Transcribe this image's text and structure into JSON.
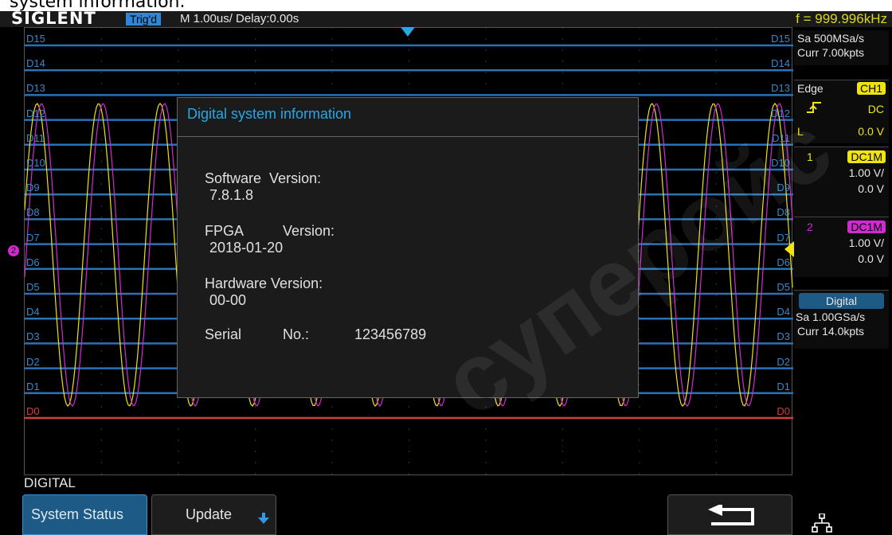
{
  "caption": "system information.",
  "header": {
    "logo": "SIGLENT",
    "trigger_status": "Trig'd",
    "timebase": "M 1.00us/  Delay:0.00s",
    "frequency": "f = 999.996kHz"
  },
  "channels_left": [
    "D15",
    "D14",
    "D13",
    "D12",
    "D11",
    "D10",
    "D9",
    "D8",
    "D7",
    "D6",
    "D5",
    "D4",
    "D3",
    "D2",
    "D1",
    "D0"
  ],
  "channels_right": [
    "D15",
    "D14",
    "D13",
    "D12",
    "D11",
    "D10",
    "D9",
    "D8",
    "D7",
    "D6",
    "D5",
    "D4",
    "D3",
    "D2",
    "D1",
    "D0"
  ],
  "marker_ch2": "2",
  "right_panel": {
    "sample_rate": "Sa 500MSa/s",
    "curr_pts": "Curr 7.00kpts",
    "trigger_type": "Edge",
    "trigger_source": "CH1",
    "coupling": "DC",
    "level_prefix": "L",
    "level": "0.0 V",
    "ch1": {
      "num": "1",
      "coupling": "DC1M",
      "scale": "1.00 V/",
      "offset": "0.0 V"
    },
    "ch2": {
      "num": "2",
      "coupling": "DC1M",
      "scale": "1.00 V/",
      "offset": "0.0 V"
    },
    "digital": {
      "label": "Digital",
      "sample_rate": "Sa 1.00GSa/s",
      "curr_pts": "Curr 14.0kpts"
    }
  },
  "dialog": {
    "title": "Digital system information",
    "software_label": "Software  Version:",
    "software_value": "7.8.1.8",
    "fpga_label": "FPGA",
    "fpga_version_label": "Version:",
    "fpga_value": "2018-01-20",
    "hardware_label": "Hardware Version:",
    "hardware_value": "00-00",
    "serial_label": "Serial",
    "serial_no_label": "No.:",
    "serial_value": "123456789"
  },
  "menu": {
    "title": "DIGITAL",
    "system_status": "System Status",
    "update": "Update"
  },
  "watermark": "супеpoйс",
  "colors": {
    "accent_blue": "#2f86d6",
    "ch1_yellow": "#f1e40e",
    "ch2_magenta": "#d12ad1",
    "digital_line": "#2a72b8",
    "d0_red": "#d04040"
  },
  "icons": [
    "back-arrow-icon",
    "network-icon",
    "down-arrow-icon"
  ]
}
